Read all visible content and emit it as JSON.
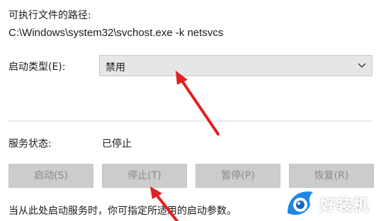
{
  "executable_path": {
    "label": "可执行文件的路径:",
    "value": "C:\\Windows\\system32\\svchost.exe -k netsvcs"
  },
  "startup_type": {
    "label": "启动类型(E):",
    "selected": "禁用"
  },
  "service_status": {
    "label": "服务状态:",
    "value": "已停止"
  },
  "buttons": {
    "start": "启动(S)",
    "stop": "停止(T)",
    "pause": "暂停(P)",
    "resume": "恢复(R)"
  },
  "hint": "当从此处启动服务时，你可指定所适用的启动参数。",
  "watermark": {
    "text": "好装机"
  },
  "colors": {
    "annotation_arrow": "#e02020",
    "disabled_button": "#cccccc",
    "combo_background": "#e6e6e6",
    "watermark_blue": "#1e88e5"
  }
}
